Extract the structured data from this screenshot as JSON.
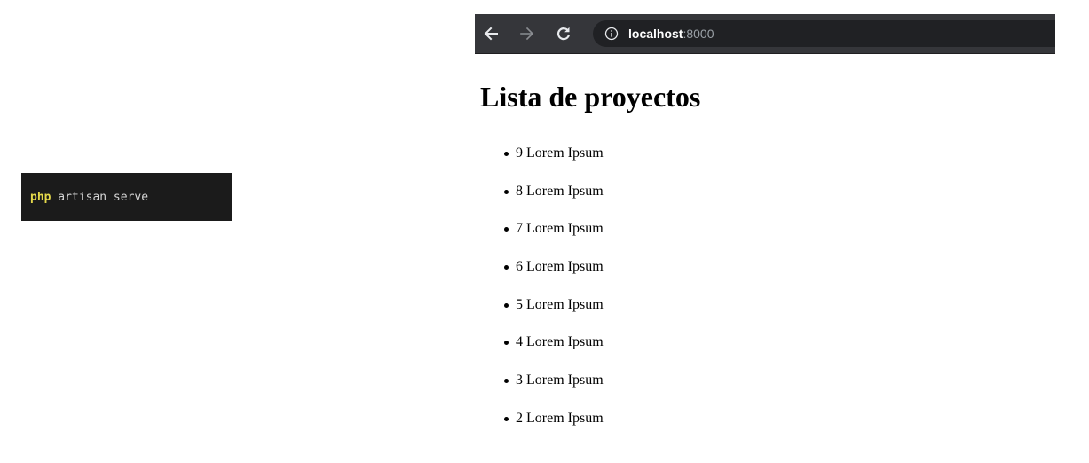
{
  "terminal": {
    "command_keyword": "php",
    "command_rest": " artisan serve"
  },
  "browser": {
    "toolbar": {
      "back_icon": "arrow-left-icon",
      "forward_icon": "arrow-right-icon",
      "reload_icon": "reload-icon",
      "info_icon": "info-icon"
    },
    "address_bar": {
      "host": "localhost",
      "port": ":8000"
    }
  },
  "page": {
    "title": "Lista de proyectos",
    "projects": [
      "9 Lorem Ipsum",
      "8 Lorem Ipsum",
      "7 Lorem Ipsum",
      "6 Lorem Ipsum",
      "5 Lorem Ipsum",
      "4 Lorem Ipsum",
      "3 Lorem Ipsum",
      "2 Lorem Ipsum"
    ]
  }
}
